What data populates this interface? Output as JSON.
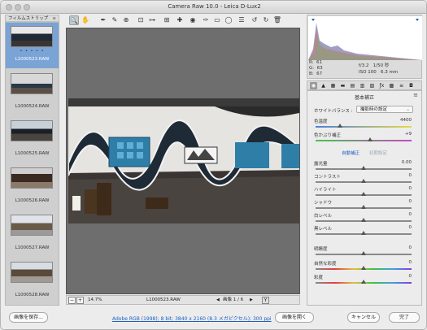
{
  "window": {
    "title": "Camera Raw 10.0  -  Leica D-Lux2"
  },
  "filmstrip": {
    "header": "フィルムストリップ",
    "header_sep": "≡",
    "items": [
      {
        "label": "L1000523.RAW",
        "selected": true,
        "rating_dots": "• • • • •"
      },
      {
        "label": "L1000524.RAW",
        "selected": false
      },
      {
        "label": "L1000525.RAW",
        "selected": false
      },
      {
        "label": "L1000526.RAW",
        "selected": false
      },
      {
        "label": "L1000527.RAW",
        "selected": false
      },
      {
        "label": "L1000528.RAW",
        "selected": false
      }
    ]
  },
  "toolbar": {
    "icons": [
      "zoom-icon",
      "hand-icon",
      "white-balance-icon",
      "color-sampler-icon",
      "targeted-adjust-icon",
      "crop-icon",
      "straighten-icon",
      "transform-icon",
      "spot-removal-icon",
      "red-eye-icon",
      "adjustment-brush-icon",
      "graduated-filter-icon",
      "radial-filter-icon",
      "preferences-icon",
      "rotate-ccw-icon",
      "rotate-cw-icon",
      "trash-icon"
    ],
    "glyphs": [
      "🔍",
      "✋",
      "✒",
      "✎",
      "⊕",
      "⊡",
      "⊶",
      "⊞",
      "✚",
      "◉",
      "✑",
      "▭",
      "◯",
      "☰",
      "↺",
      "↻",
      "🗑"
    ]
  },
  "preview": {
    "zoom": "14.7%",
    "filename": "L1000523.RAW",
    "image_counter": "画像 1 / 6",
    "view_y": "Y",
    "minus": "−",
    "plus": "+",
    "prev": "◀",
    "next": "▶"
  },
  "histogram": {
    "r_label": "R:",
    "r_value": "61",
    "g_label": "G:",
    "g_value": "63",
    "b_label": "B:",
    "b_value": "67",
    "aperture": "f/3.2",
    "shutter": "1/50 秒",
    "iso": "ISO 100",
    "focal": "6.3 mm"
  },
  "panel": {
    "title": "基本補正",
    "menu_icon": "≡",
    "wb_label": "ホワイトバランス :",
    "wb_value": "撮影時の設定",
    "wb_chevron": "⌄",
    "auto_label": "自動補正",
    "default_label": "初期設定",
    "sliders": [
      {
        "key": "temp",
        "label": "色温度",
        "value": "4400",
        "pos": 0.25,
        "track": "linear-gradient(90deg,#4d7fd8,#e8d84a)"
      },
      {
        "key": "tint",
        "label": "色かぶり補正",
        "value": "+9",
        "pos": 0.57,
        "track": "linear-gradient(90deg,#4cc24c,#c24cc2)"
      },
      {
        "key": "exposure",
        "label": "露光量",
        "value": "0.00",
        "pos": 0.5,
        "track": "#8a8a8a"
      },
      {
        "key": "contrast",
        "label": "コントラスト",
        "value": "0",
        "pos": 0.5,
        "track": "#8a8a8a"
      },
      {
        "key": "highlights",
        "label": "ハイライト",
        "value": "0",
        "pos": 0.5,
        "track": "#8a8a8a"
      },
      {
        "key": "shadows",
        "label": "シャドウ",
        "value": "0",
        "pos": 0.5,
        "track": "#8a8a8a"
      },
      {
        "key": "whites",
        "label": "白レベル",
        "value": "0",
        "pos": 0.5,
        "track": "#8a8a8a"
      },
      {
        "key": "blacks",
        "label": "黒レベル",
        "value": "0",
        "pos": 0.5,
        "track": "#8a8a8a"
      },
      {
        "key": "clarity",
        "label": "明瞭度",
        "value": "0",
        "pos": 0.5,
        "track": "#8a8a8a"
      },
      {
        "key": "vibrance",
        "label": "自然な彩度",
        "value": "0",
        "pos": 0.5,
        "track": "linear-gradient(90deg,#8a8a8a,#e04040,#e0c040,#40c040,#40a0e0,#8040e0)"
      },
      {
        "key": "saturation",
        "label": "彩度",
        "value": "0",
        "pos": 0.5,
        "track": "linear-gradient(90deg,#8a8a8a,#e04040,#e0c040,#40c040,#40a0e0,#8040e0)"
      }
    ]
  },
  "panel_tabs": [
    "◉",
    "▲",
    "▦",
    "▬",
    "▤",
    "▥",
    "▨",
    "ƒx",
    "▩",
    "≡",
    "◘"
  ],
  "footer": {
    "save_label": "画像を保存...",
    "workflow_link": "Adobe RGB (1998); 8 bit; 3840 x 2160 (8.3 メガピクセル); 300 ppi",
    "open_label": "画像を開く",
    "cancel_label": "キャンセル",
    "done_label": "完了"
  },
  "colors": {
    "accent": "#1d5fbf",
    "selection": "#7aa3d6"
  }
}
